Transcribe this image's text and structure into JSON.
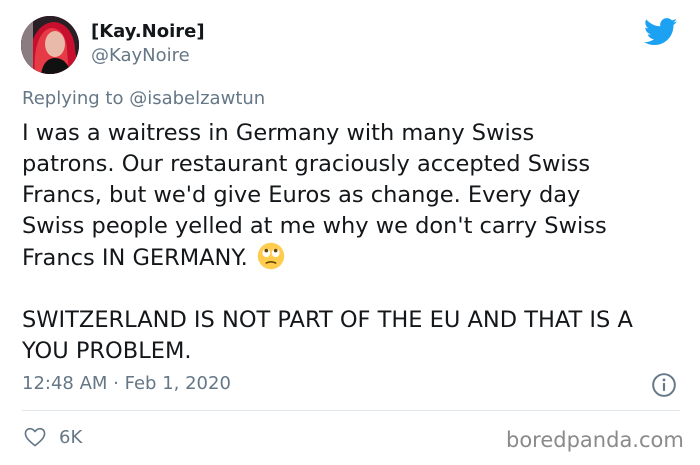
{
  "tweet": {
    "display_name": "[Kay.Noire]",
    "handle": "@KayNoire",
    "reply_prefix": "Replying to ",
    "reply_to": "@isabelzawtun",
    "body_line1": "I was a waitress in Germany with many Swiss\npatrons. Our restaurant graciously accepted Swiss\nFrancs, but we'd give Euros as change. Every day\nSwiss people yelled at me why we don't carry Swiss\nFrancs IN GERMANY. ",
    "body_line2": "SWITZERLAND IS NOT PART OF THE EU AND THAT IS A\nYOU PROBLEM.",
    "emoji": "face-with-rolling-eyes",
    "timestamp": "12:48 AM · Feb 1, 2020",
    "like_count": "6K"
  },
  "icons": {
    "brand": "twitter-bird-icon",
    "info": "info-icon",
    "like": "heart-icon"
  },
  "colors": {
    "twitter_blue": "#1da1f2",
    "secondary_text": "#657786",
    "primary_text": "#14171a"
  },
  "watermark": "boredpanda.com"
}
